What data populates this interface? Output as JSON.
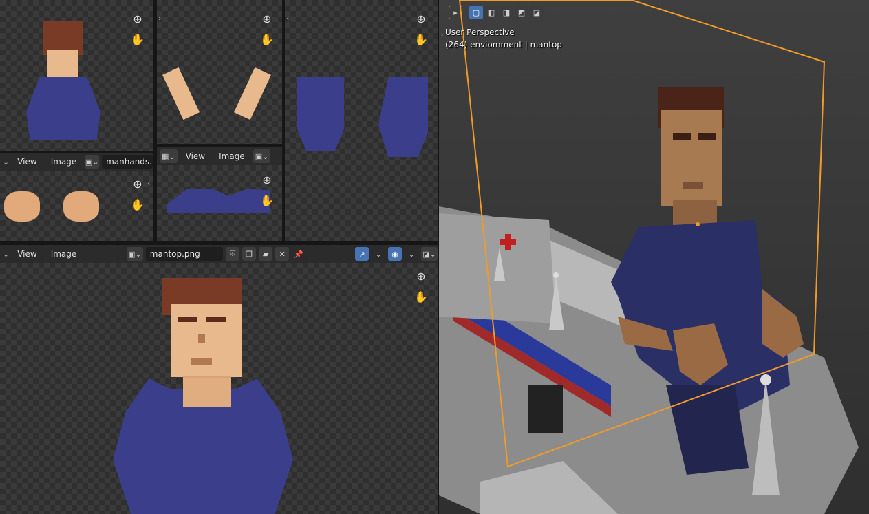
{
  "panels": {
    "top_left_header_caret": "⌄",
    "manhands": {
      "menu_view": "View",
      "menu_image": "Image",
      "image_name": "manhands.pn"
    },
    "middle": {
      "menu_view": "View",
      "menu_image": "Image"
    },
    "main": {
      "menu_view": "View",
      "menu_image": "Image",
      "image_name": "mantop.png"
    }
  },
  "viewport": {
    "perspective_label": "User Perspective",
    "object_info": "(264) enviomment | mantop"
  },
  "icons": {
    "zoom": "zoom-in-icon",
    "pan": "hand-pan-icon",
    "pin": "pin-icon",
    "shield": "fake-user-shield-icon",
    "duplicate": "duplicate-icon",
    "folder": "folder-icon",
    "close": "close-icon"
  },
  "colors": {
    "accent": "#4772b3",
    "selection_outline": "#f09a2a",
    "skin": "#e8b98c",
    "hair": "#7a3b26",
    "shirt": "#3b3e8a"
  }
}
